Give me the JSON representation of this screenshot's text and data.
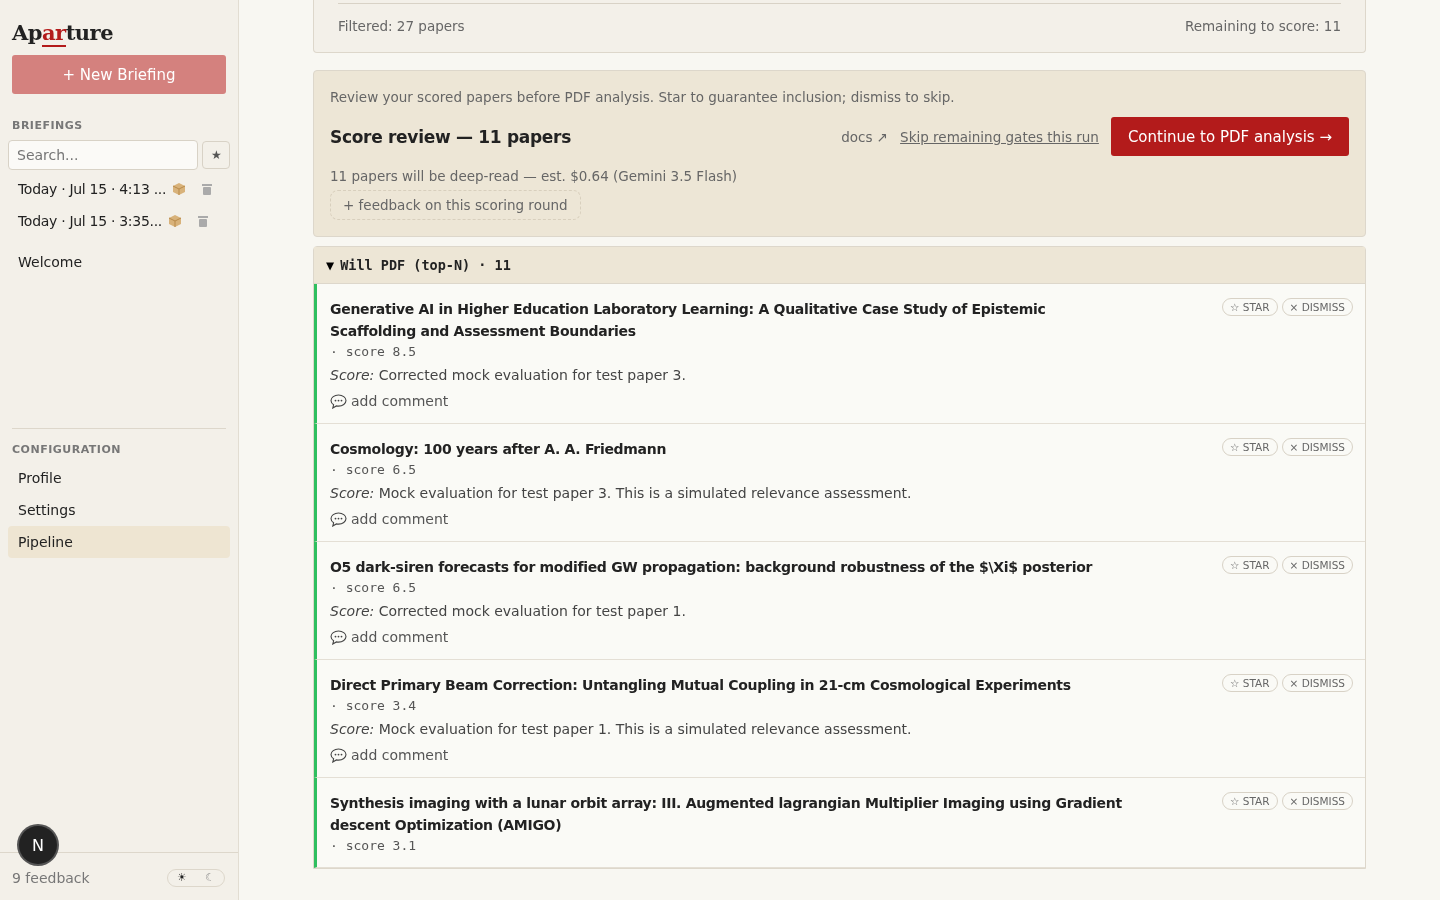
{
  "sidebar": {
    "logo": {
      "before": "Ap",
      "accent": "ar",
      "after": "ture"
    },
    "new_button": "+ New Briefing",
    "briefings_heading": "BRIEFINGS",
    "search": {
      "placeholder": "Search..."
    },
    "starred_filter": {
      "label": "★",
      "on": false
    },
    "briefings": [
      {
        "label": "Today · Jul 15 · 4:13 ...",
        "selected": false
      },
      {
        "label": "Today · Jul 15 · 3:35...",
        "selected": false
      }
    ],
    "welcome": {
      "label": "Welcome",
      "selected": false
    },
    "config_heading": "CONFIGURATION",
    "config_items": [
      {
        "label": "Profile",
        "selected": false
      },
      {
        "label": "Settings",
        "selected": false
      },
      {
        "label": "Pipeline",
        "selected": true
      }
    ],
    "feedback": "9 feedback",
    "avatar": "N",
    "theme": [
      {
        "glyph": "☀",
        "selected": true
      },
      {
        "glyph": "☾",
        "selected": false
      }
    ]
  },
  "stats": {
    "filtered": "Filtered: 27 papers",
    "remaining": "Remaining to score: 11"
  },
  "review": {
    "intro": "Review your scored papers before PDF analysis. Star to guarantee inclusion; dismiss to skip.",
    "title": "Score review — 11 papers",
    "docs": "docs ↗",
    "skip": "Skip remaining gates this run",
    "continue": "Continue to PDF analysis →",
    "estimate": "11 papers will be deep-read — est. $0.64 (Gemini 3.5 Flash)",
    "feedback": "+ feedback on this scoring round"
  },
  "group": {
    "toggle": "▼",
    "title": "Will PDF (top-N) · 11",
    "expanded": true,
    "papers": [
      {
        "title": "Generative AI in Higher Education Laboratory Learning: A Qualitative Case Study of Epistemic Scaffolding and Assessment Boundaries",
        "score": "· score 8.5",
        "label": "Score:",
        "reason": "Corrected mock evaluation for test paper 3.",
        "comment": "add comment",
        "star": "☆ STAR",
        "dismiss": "× DISMISS",
        "starred": false
      },
      {
        "title": "Cosmology: 100 years after A. A. Friedmann",
        "score": "· score 6.5",
        "label": "Score:",
        "reason": "Mock evaluation for test paper 3. This is a simulated relevance assessment.",
        "comment": "add comment",
        "star": "☆ STAR",
        "dismiss": "× DISMISS",
        "starred": false
      },
      {
        "title": "O5 dark-siren forecasts for modified GW propagation: background robustness of the $\\Xi$ posterior",
        "score": "· score 6.5",
        "label": "Score:",
        "reason": "Corrected mock evaluation for test paper 1.",
        "comment": "add comment",
        "star": "☆ STAR",
        "dismiss": "× DISMISS",
        "starred": false
      },
      {
        "title": "Direct Primary Beam Correction: Untangling Mutual Coupling in 21-cm Cosmological Experiments",
        "score": "· score 3.4",
        "label": "Score:",
        "reason": "Mock evaluation for test paper 1. This is a simulated relevance assessment.",
        "comment": "add comment",
        "star": "☆ STAR",
        "dismiss": "× DISMISS",
        "starred": false
      },
      {
        "title": "Synthesis imaging with a lunar orbit array: III. Augmented lagrangian Multiplier Imaging using Gradient descent Optimization (AMIGO)",
        "score": "· score 3.1",
        "star": "☆ STAR",
        "dismiss": "× DISMISS",
        "starred": false
      }
    ]
  }
}
